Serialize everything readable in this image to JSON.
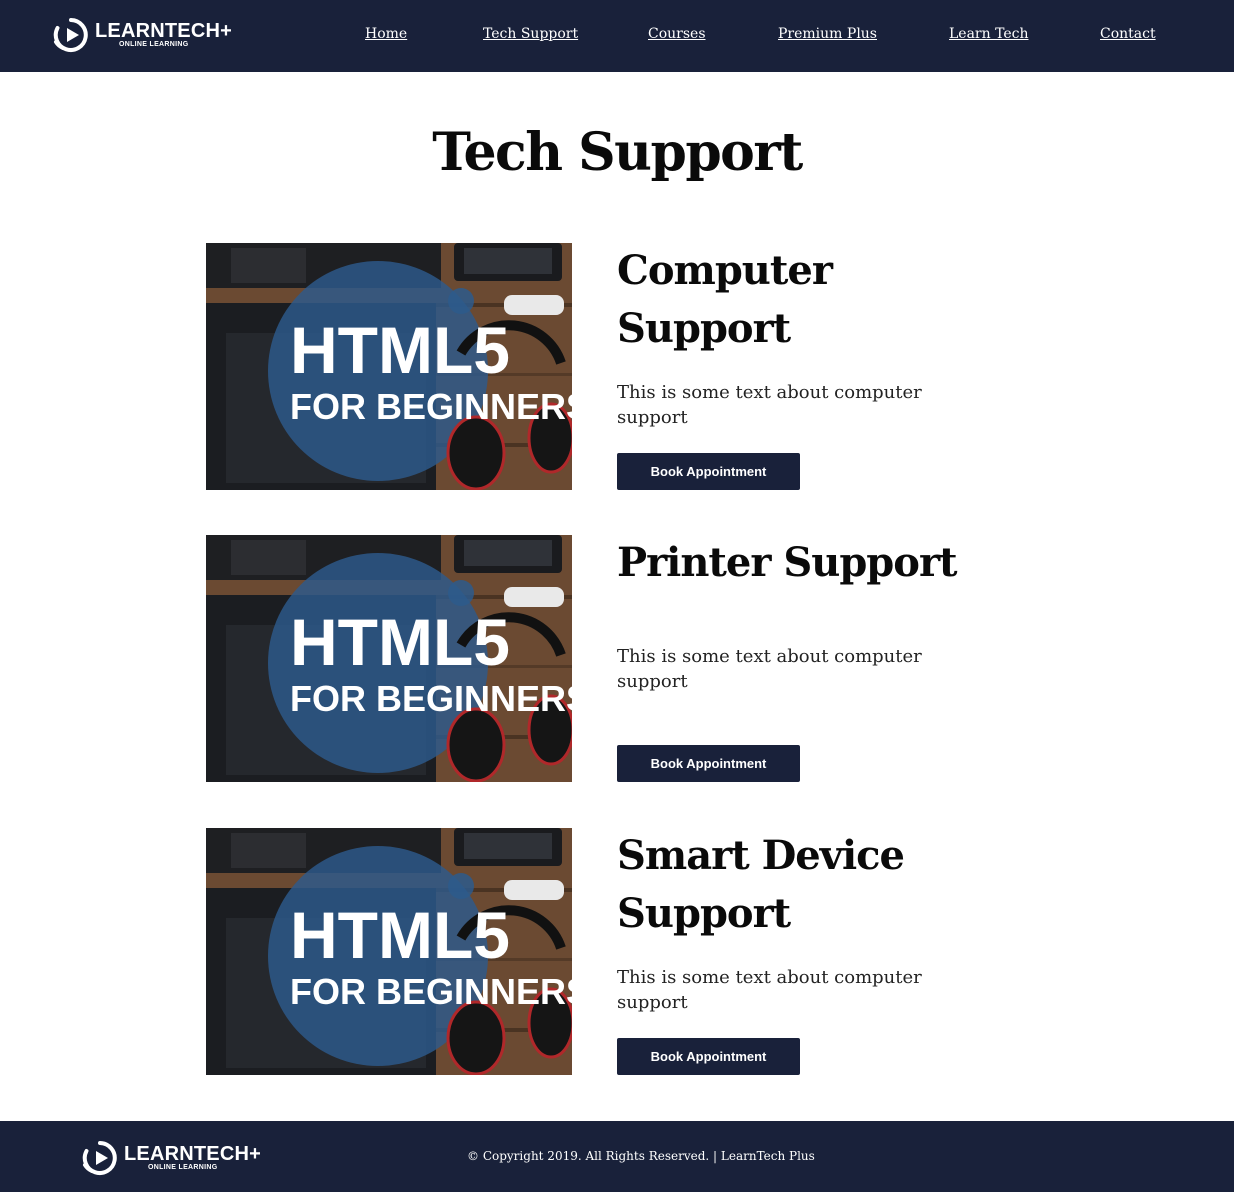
{
  "brand": {
    "name": "LEARNTECH+",
    "tagline": "ONLINE LEARNING",
    "logo_icon": "play-circle-icon"
  },
  "nav": {
    "items": [
      {
        "label": "Home"
      },
      {
        "label": "Tech Support"
      },
      {
        "label": "Courses"
      },
      {
        "label": "Premium Plus"
      },
      {
        "label": "Learn Tech"
      },
      {
        "label": "Contact"
      }
    ]
  },
  "page": {
    "title": "Tech Support"
  },
  "cards": [
    {
      "heading": "Computer Support",
      "text": "This is some text about computer support",
      "button": "Book Appointment",
      "image_text": [
        "HTML5",
        "FOR BEGINNERS"
      ]
    },
    {
      "heading": "Printer Support",
      "text": "This is some text about computer support",
      "button": "Book Appointment",
      "image_text": [
        "HTML5",
        "FOR BEGINNERS"
      ]
    },
    {
      "heading": "Smart Device Support",
      "text": "This is some text about computer support",
      "button": "Book Appointment",
      "image_text": [
        "HTML5",
        "FOR BEGINNERS"
      ]
    }
  ],
  "footer": {
    "copyright": "© Copyright 2019. All Rights Reserved. | LearnTech Plus"
  },
  "colors": {
    "navy": "#19213a",
    "background": "#ffffff",
    "text": "#0a0a0a"
  }
}
